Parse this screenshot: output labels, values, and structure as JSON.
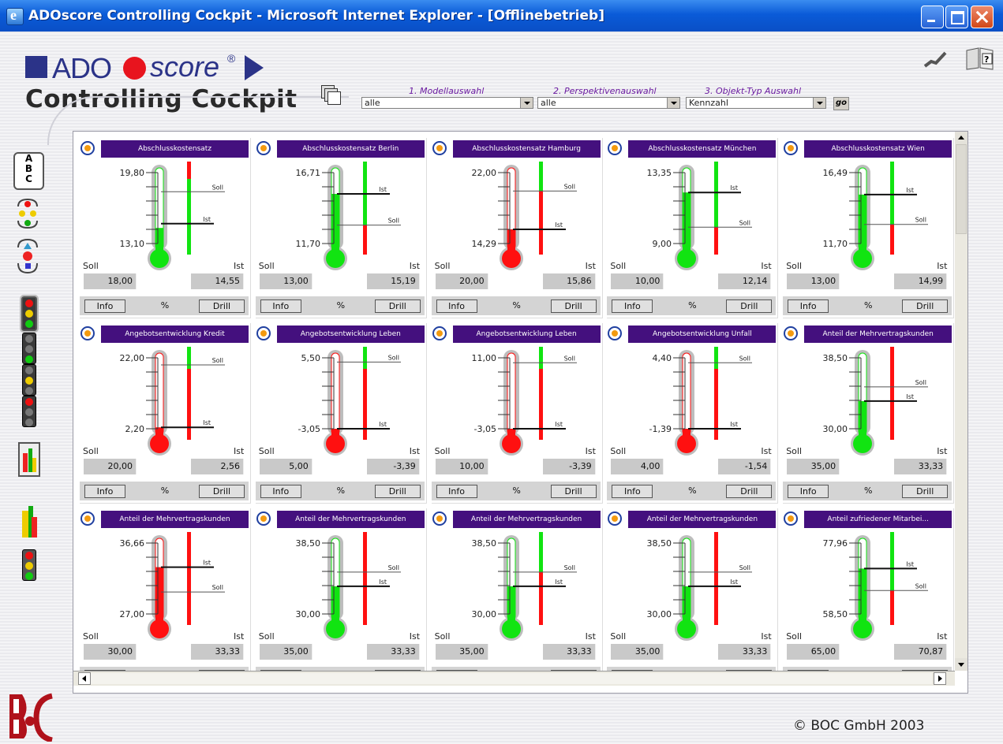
{
  "window": {
    "title": "ADOscore Controlling Cockpit - Microsoft Internet Explorer - [Offlinebetrieb]"
  },
  "header": {
    "logo_ado": "ADO",
    "logo_score": "score",
    "logo_reg": "®",
    "subtitle": "Controlling Cockpit",
    "copyright": "© BOC GmbH 2003"
  },
  "selectors": [
    {
      "label": "1. Modellauswahl",
      "value": "alle"
    },
    {
      "label": "2. Perspektivenauswahl",
      "value": "alle"
    },
    {
      "label": "3. Objekt-Typ Auswahl",
      "value": "Kennzahl"
    }
  ],
  "go_label": "go",
  "left_toolbar": {
    "abc_text_1": "A",
    "abc_text_2": "B",
    "abc_text_3": "C"
  },
  "card_labels": {
    "soll": "Soll",
    "ist": "Ist",
    "info": "Info",
    "unit": "%",
    "drill": "Drill"
  },
  "cards": [
    {
      "title": "Abschlusskostensatz",
      "max": "19,80",
      "min": "13,10",
      "soll": "18,00",
      "ist": "14,55",
      "ist_level": 0.22,
      "soll_frac": 0.73,
      "ist_frac": 0.28,
      "color": "green",
      "band": "green-only",
      "soll_first": true
    },
    {
      "title": "Abschlusskostensatz Berlin",
      "max": "16,71",
      "min": "11,70",
      "soll": "13,00",
      "ist": "15,19",
      "ist_level": 0.7,
      "soll_frac": 0.26,
      "ist_frac": 0.7,
      "color": "green",
      "band": "green-top",
      "soll_first": false
    },
    {
      "title": "Abschlusskostensatz Hamburg",
      "max": "22,00",
      "min": "14,29",
      "soll": "20,00",
      "ist": "15,86",
      "ist_level": 0.2,
      "soll_frac": 0.74,
      "ist_frac": 0.2,
      "color": "red",
      "band": "green-top-small",
      "soll_first": true
    },
    {
      "title": "Abschlusskostensatz München",
      "max": "13,35",
      "min": "9,00",
      "soll": "10,00",
      "ist": "12,14",
      "ist_level": 0.72,
      "soll_frac": 0.23,
      "ist_frac": 0.72,
      "color": "green",
      "band": "green-top",
      "soll_first": false
    },
    {
      "title": "Abschlusskostensatz Wien",
      "max": "16,49",
      "min": "11,70",
      "soll": "13,00",
      "ist": "14,99",
      "ist_level": 0.69,
      "soll_frac": 0.27,
      "ist_frac": 0.69,
      "color": "green",
      "band": "green-top",
      "soll_first": false
    },
    {
      "title": "Angebotsentwicklung Kredit",
      "max": "22,00",
      "min": "2,20",
      "soll": "20,00",
      "ist": "2,56",
      "ist_level": 0.02,
      "soll_frac": 0.9,
      "ist_frac": 0.02,
      "color": "red",
      "band": "red-low",
      "soll_first": true
    },
    {
      "title": "Angebotsentwicklung Leben",
      "max": "5,50",
      "min": "-3,05",
      "soll": "5,00",
      "ist": "-3,39",
      "ist_level": 0.0,
      "soll_frac": 0.94,
      "ist_frac": 0.0,
      "color": "red",
      "band": "red-low",
      "soll_first": true
    },
    {
      "title": "Angebotsentwicklung Leben",
      "max": "11,00",
      "min": "-3,05",
      "soll": "10,00",
      "ist": "-3,39",
      "ist_level": 0.0,
      "soll_frac": 0.93,
      "ist_frac": 0.0,
      "color": "red",
      "band": "red-low",
      "soll_first": true
    },
    {
      "title": "Angebotsentwicklung Unfall",
      "max": "4,40",
      "min": "-1,39",
      "soll": "4,00",
      "ist": "-1,54",
      "ist_level": 0.0,
      "soll_frac": 0.93,
      "ist_frac": 0.0,
      "color": "red",
      "band": "red-low",
      "soll_first": true
    },
    {
      "title": "Anteil der Mehrvertragskunden",
      "max": "38,50",
      "min": "30,00",
      "soll": "35,00",
      "ist": "33,33",
      "ist_level": 0.39,
      "soll_frac": 0.59,
      "ist_frac": 0.39,
      "color": "green",
      "band": "red-all",
      "soll_first": true
    },
    {
      "title": "Anteil der Mehrvertragskunden",
      "max": "36,66",
      "min": "27,00",
      "soll": "30,00",
      "ist": "33,33",
      "ist_level": 0.66,
      "soll_frac": 0.31,
      "ist_frac": 0.66,
      "color": "red",
      "band": "red-all",
      "soll_first": false
    },
    {
      "title": "Anteil der Mehrvertragskunden",
      "max": "38,50",
      "min": "30,00",
      "soll": "35,00",
      "ist": "33,33",
      "ist_level": 0.39,
      "soll_frac": 0.59,
      "ist_frac": 0.39,
      "color": "green",
      "band": "red-all",
      "soll_first": true
    },
    {
      "title": "Anteil der Mehrvertragskunden",
      "max": "38,50",
      "min": "30,00",
      "soll": "35,00",
      "ist": "33,33",
      "ist_level": 0.39,
      "soll_frac": 0.59,
      "ist_frac": 0.39,
      "color": "green",
      "band": "green-top-small",
      "soll_first": true
    },
    {
      "title": "Anteil der Mehrvertragskunden",
      "max": "38,50",
      "min": "30,00",
      "soll": "35,00",
      "ist": "33,33",
      "ist_level": 0.39,
      "soll_frac": 0.59,
      "ist_frac": 0.39,
      "color": "green",
      "band": "red-all",
      "soll_first": true
    },
    {
      "title": "Anteil zufriedener Mitarbei...",
      "max": "77,96",
      "min": "58,50",
      "soll": "65,00",
      "ist": "70,87",
      "ist_level": 0.64,
      "soll_frac": 0.33,
      "ist_frac": 0.64,
      "color": "green",
      "band": "green-top",
      "soll_first": false
    }
  ],
  "colors": {
    "title_bar": "#0a5bd8",
    "card_header": "#44107e",
    "green": "#11e411",
    "red": "#ff1010",
    "brand": "#2b3388"
  }
}
